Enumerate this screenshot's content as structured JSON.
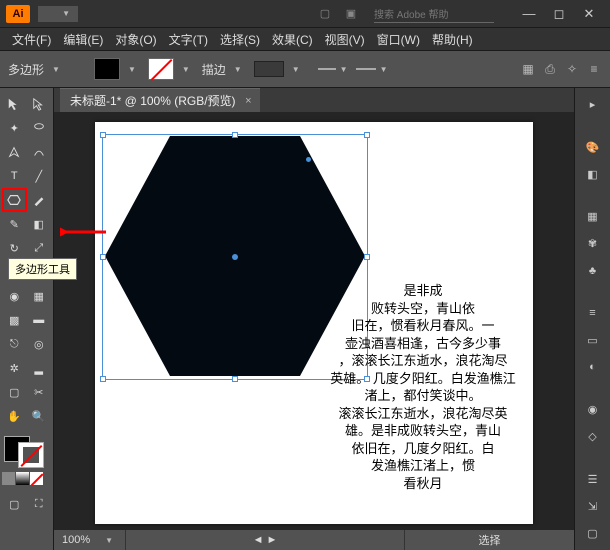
{
  "app": {
    "logo": "Ai",
    "search_placeholder": "搜索 Adobe 帮助"
  },
  "menubar": {
    "items": [
      {
        "label": "文件(F)"
      },
      {
        "label": "编辑(E)"
      },
      {
        "label": "对象(O)"
      },
      {
        "label": "文字(T)"
      },
      {
        "label": "选择(S)"
      },
      {
        "label": "效果(C)"
      },
      {
        "label": "视图(V)"
      },
      {
        "label": "窗口(W)"
      },
      {
        "label": "帮助(H)"
      }
    ]
  },
  "controlbar": {
    "selection_label": "多边形",
    "stroke_label": "描边",
    "fill_color": "#000000",
    "stroke_none": true
  },
  "document": {
    "tab_title": "未标题-1* @ 100% (RGB/预览)",
    "zoom": "100%",
    "status_left": "",
    "status_right": "选择"
  },
  "tooltip": {
    "polygon": "多边形工具"
  },
  "poem": {
    "text": "是非成\n败转头空，青山依\n旧在，惯看秋月春风。一\n壶浊酒喜相逢，古今多少事\n，滚滚长江东逝水，浪花淘尽\n英雄。 几度夕阳红。白发渔樵江\n渚上，都付笑谈中。\n滚滚长江东逝水，浪花淘尽英\n雄。是非成败转头空，青山\n依旧在，几度夕阳红。白\n发渔樵江渚上，惯\n看秋月"
  },
  "colors": {
    "accent": "#4a90d9",
    "highlight": "#ff0000"
  }
}
